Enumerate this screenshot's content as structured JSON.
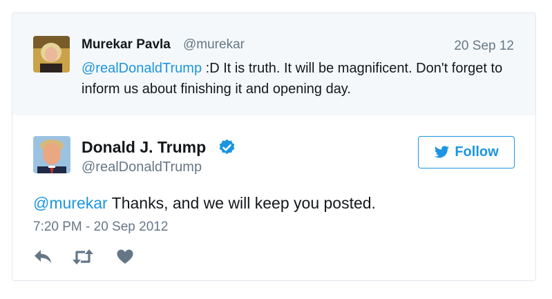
{
  "parent_tweet": {
    "name": "Murekar Pavla",
    "handle": "@murekar",
    "date": "20 Sep 12",
    "mention": "@realDonaldTrump",
    "text": " :D It is truth. It will be magnificent. Don't forget to inform us about finishing it and opening day."
  },
  "tweet": {
    "name": "Donald J. Trump",
    "handle": "@realDonaldTrump",
    "verified_icon": "verified-badge-icon",
    "follow_label": "Follow",
    "mention": "@murekar",
    "text": " Thanks, and we will keep you posted.",
    "timestamp": "7:20 PM - 20 Sep 2012"
  },
  "actions": [
    "reply-icon",
    "retweet-icon",
    "like-icon"
  ],
  "colors": {
    "link": "#1b95e0",
    "muted": "#657786",
    "text": "#14171a",
    "parent_bg": "#f5f8fa",
    "border": "#e1e8ed"
  }
}
